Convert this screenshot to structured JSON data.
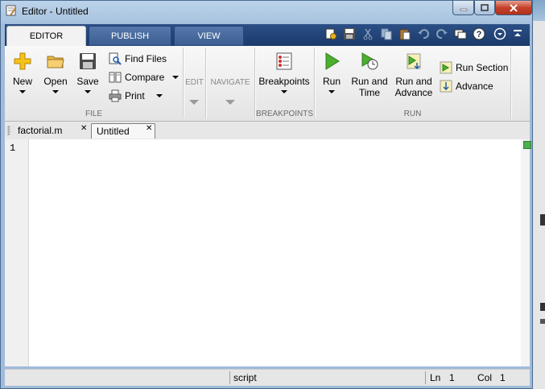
{
  "window": {
    "title": "Editor - Untitled"
  },
  "tabs": [
    {
      "label": "EDITOR"
    },
    {
      "label": "PUBLISH"
    },
    {
      "label": "VIEW"
    }
  ],
  "ribbon": {
    "file": {
      "new_label": "New",
      "open_label": "Open",
      "save_label": "Save",
      "find_files_label": "Find Files",
      "compare_label": "Compare",
      "print_label": "Print",
      "group_label": "FILE"
    },
    "edit": {
      "label": "EDIT"
    },
    "navigate": {
      "label": "NAVIGATE"
    },
    "breakpoints": {
      "button_label": "Breakpoints",
      "group_label": "BREAKPOINTS"
    },
    "run": {
      "run_label": "Run",
      "run_time_line1": "Run and",
      "run_time_line2": "Time",
      "run_advance_line1": "Run and",
      "run_advance_line2": "Advance",
      "run_section_label": "Run Section",
      "advance_label": "Advance",
      "group_label": "RUN"
    }
  },
  "documents": [
    {
      "label": "factorial.m"
    },
    {
      "label": "Untitled"
    }
  ],
  "editor": {
    "line_numbers": [
      "1"
    ]
  },
  "status": {
    "mode": "script",
    "ln_label": "Ln",
    "ln_value": "1",
    "col_label": "Col",
    "col_value": "1"
  }
}
